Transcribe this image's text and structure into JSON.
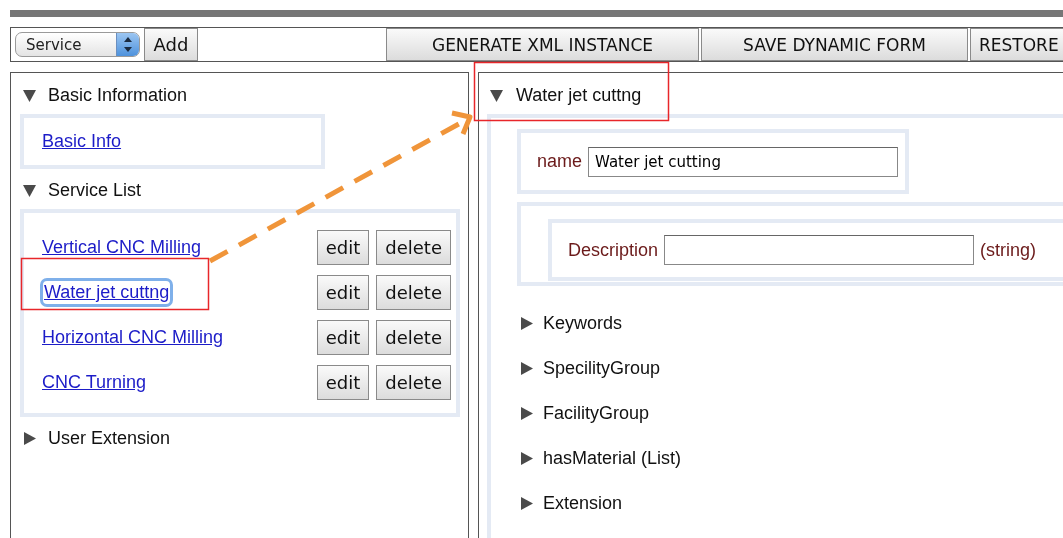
{
  "toolbar": {
    "type_select": {
      "value": "Service"
    },
    "add_button": "Add",
    "actions": [
      "GENERATE XML INSTANCE",
      "SAVE DYNAMIC FORM",
      "RESTORE"
    ]
  },
  "left_panel": {
    "sections": [
      {
        "title": "Basic Information",
        "expanded": true,
        "kind": "links",
        "items": [
          {
            "label": "Basic Info"
          }
        ]
      },
      {
        "title": "Service List",
        "expanded": true,
        "kind": "services",
        "items": [
          {
            "label": "Vertical CNC Milling",
            "focused": false,
            "actions": [
              "edit",
              "delete"
            ]
          },
          {
            "label": "Water jet cuttng",
            "focused": true,
            "actions": [
              "edit",
              "delete"
            ]
          },
          {
            "label": "Horizontal CNC Milling",
            "focused": false,
            "actions": [
              "edit",
              "delete"
            ]
          },
          {
            "label": "CNC Turning",
            "focused": false,
            "actions": [
              "edit",
              "delete"
            ]
          }
        ]
      },
      {
        "title": "User Extension",
        "expanded": false
      }
    ]
  },
  "right_panel": {
    "title": "Water jet cuttng",
    "expanded": true,
    "fields": [
      {
        "kind": "text",
        "label": "name",
        "value": "Water jet cutting"
      },
      {
        "kind": "nested",
        "label": "Description",
        "suffix": "(string)"
      }
    ],
    "groups": [
      {
        "label": "Keywords",
        "expanded": false
      },
      {
        "label": "SpecilityGroup",
        "expanded": false
      },
      {
        "label": "FacilityGroup",
        "expanded": false
      },
      {
        "label": "hasMaterial (List)",
        "expanded": false
      },
      {
        "label": "Extension",
        "expanded": false
      }
    ]
  }
}
